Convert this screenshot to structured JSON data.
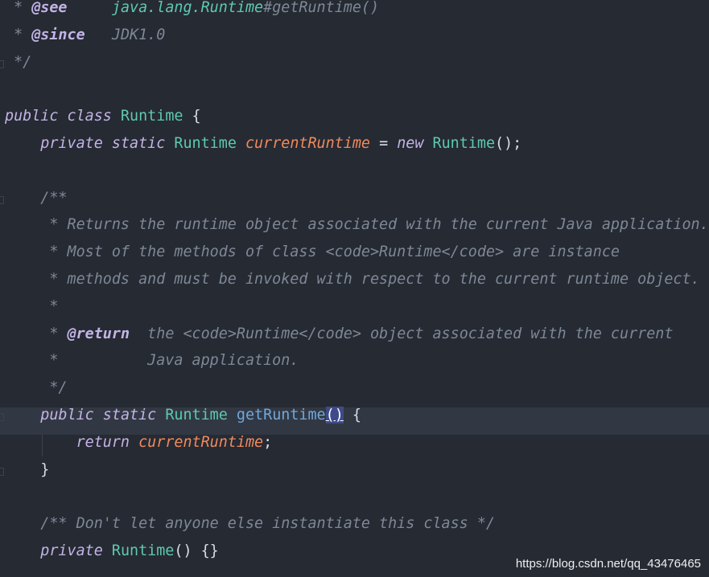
{
  "code": {
    "lines": [
      {
        "parts": [
          {
            "t": " * ",
            "c": "cm"
          },
          {
            "t": "@see",
            "c": "tag"
          },
          {
            "t": "     ",
            "c": "cm"
          },
          {
            "t": "java.lang.Runtime",
            "c": "ref"
          },
          {
            "t": "#getRuntime()",
            "c": "cm"
          }
        ]
      },
      {
        "parts": [
          {
            "t": " * ",
            "c": "cm"
          },
          {
            "t": "@since",
            "c": "tag"
          },
          {
            "t": "   JDK1.0",
            "c": "cm"
          }
        ]
      },
      {
        "parts": [
          {
            "t": " */",
            "c": "cm"
          }
        ]
      },
      {
        "parts": []
      },
      {
        "parts": [
          {
            "t": "public ",
            "c": "kw"
          },
          {
            "t": "class ",
            "c": "kw"
          },
          {
            "t": "Runtime",
            "c": "ty"
          },
          {
            "t": " {",
            "c": "pu"
          }
        ]
      },
      {
        "parts": [
          {
            "t": "    private ",
            "c": "kw"
          },
          {
            "t": "static ",
            "c": "kw"
          },
          {
            "t": "Runtime",
            "c": "ty"
          },
          {
            "t": " ",
            "c": "pu"
          },
          {
            "t": "currentRuntime",
            "c": "fld"
          },
          {
            "t": " = ",
            "c": "pu"
          },
          {
            "t": "new ",
            "c": "kw"
          },
          {
            "t": "Runtime",
            "c": "ty"
          },
          {
            "t": "();",
            "c": "pu"
          }
        ]
      },
      {
        "parts": []
      },
      {
        "parts": [
          {
            "t": "    /**",
            "c": "cm"
          }
        ]
      },
      {
        "parts": [
          {
            "t": "     * Returns the runtime object associated with the current Java application.",
            "c": "cm"
          }
        ]
      },
      {
        "parts": [
          {
            "t": "     * Most of the methods of class <code>Runtime</code> are instance",
            "c": "cm"
          }
        ]
      },
      {
        "parts": [
          {
            "t": "     * methods and must be invoked with respect to the current runtime object.",
            "c": "cm"
          }
        ]
      },
      {
        "parts": [
          {
            "t": "     *",
            "c": "cm"
          }
        ]
      },
      {
        "parts": [
          {
            "t": "     * ",
            "c": "cm"
          },
          {
            "t": "@return",
            "c": "tag"
          },
          {
            "t": "  the <code>Runtime</code> object associated with the current",
            "c": "cm"
          }
        ]
      },
      {
        "parts": [
          {
            "t": "     *          Java application.",
            "c": "cm"
          }
        ]
      },
      {
        "parts": [
          {
            "t": "     */",
            "c": "cm"
          }
        ]
      },
      {
        "highlight": true,
        "parts": [
          {
            "t": "    public ",
            "c": "kw"
          },
          {
            "t": "static ",
            "c": "kw"
          },
          {
            "t": "Runtime",
            "c": "ty"
          },
          {
            "t": " ",
            "c": "pu"
          },
          {
            "t": "getRuntime",
            "c": "fn"
          },
          {
            "t": "()",
            "c": "paren-hl"
          },
          {
            "t": " {",
            "c": "pu"
          }
        ]
      },
      {
        "parts": [
          {
            "t": "        return ",
            "c": "kw"
          },
          {
            "t": "currentRuntime",
            "c": "fld"
          },
          {
            "t": ";",
            "c": "pu"
          }
        ]
      },
      {
        "parts": [
          {
            "t": "    }",
            "c": "pu"
          }
        ]
      },
      {
        "parts": []
      },
      {
        "parts": [
          {
            "t": "    /** Don't let anyone else instantiate this class */",
            "c": "cm"
          }
        ]
      },
      {
        "parts": [
          {
            "t": "    private ",
            "c": "kw"
          },
          {
            "t": "Runtime",
            "c": "ty"
          },
          {
            "t": "() {}",
            "c": "pu"
          }
        ]
      }
    ]
  },
  "gutter_marks": [
    2,
    7,
    15,
    17
  ],
  "watermark": "https://blog.csdn.net/qq_43476465",
  "colors": {
    "background": "#262a33",
    "keyword": "#c3b4e6",
    "type": "#5ec9b0",
    "field": "#f08a5d",
    "method": "#6fa8dc",
    "comment": "#7e8896"
  }
}
